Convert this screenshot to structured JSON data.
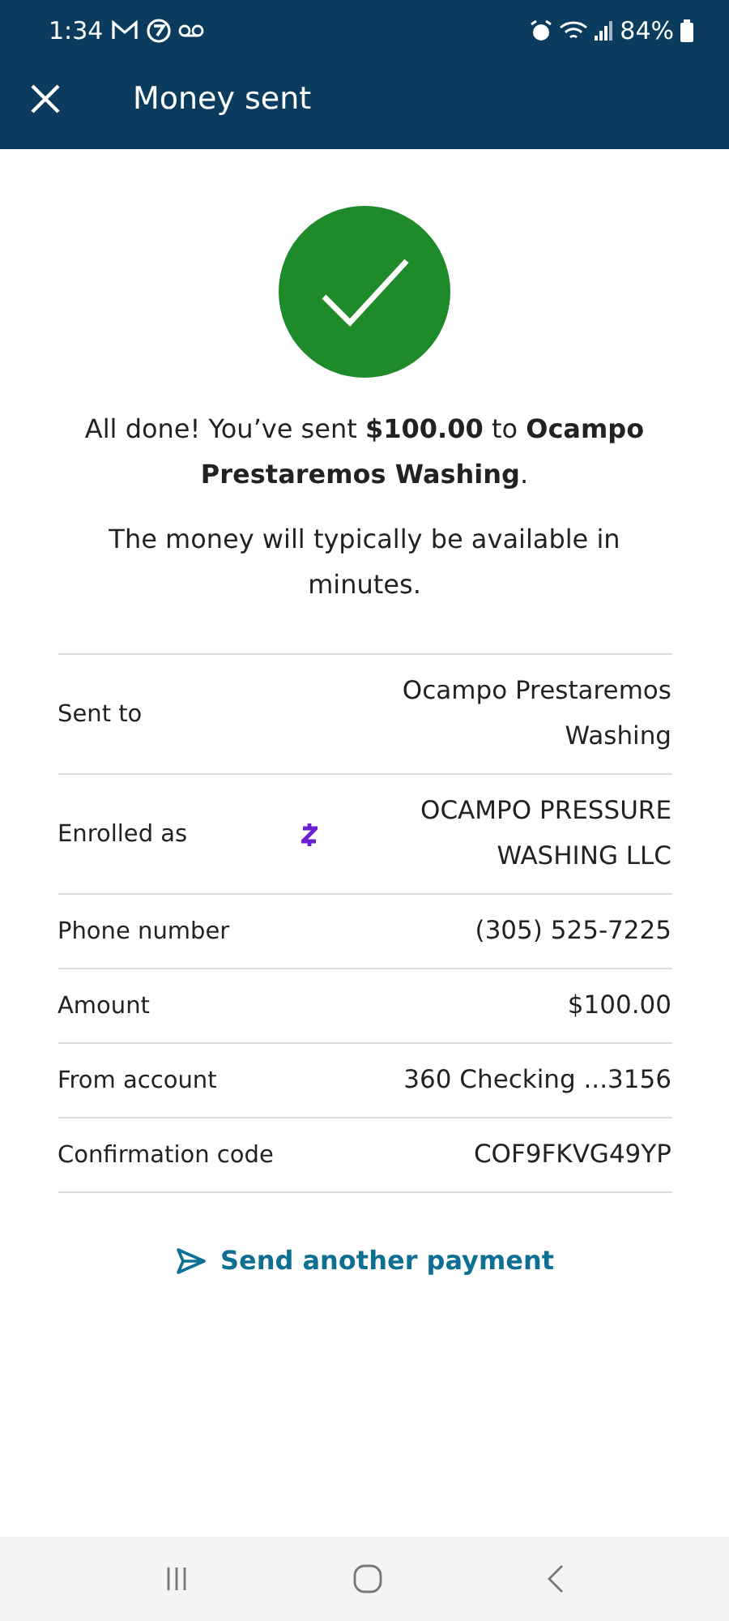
{
  "status_bar": {
    "time": "1:34",
    "battery": "84%"
  },
  "header": {
    "title": "Money sent"
  },
  "message": {
    "text": "All done! You’ve sent **$100.00** to **Ocampo Prestaremos Washing**.",
    "note": "The money will typically be available in minutes."
  },
  "details": [
    {
      "label": "Sent to",
      "value": "Ocampo Prestaremos Washing",
      "zelle_icon": false
    },
    {
      "label": "Enrolled as",
      "value": "OCAMPO PRESSURE WASHING LLC",
      "zelle_icon": true
    },
    {
      "label": "Phone number",
      "value": "(305) 525-7225",
      "zelle_icon": false
    },
    {
      "label": "Amount",
      "value": "$100.00",
      "zelle_icon": false
    },
    {
      "label": "From account",
      "value": "360 Checking ...3156",
      "zelle_icon": false
    },
    {
      "label": "Confirmation code",
      "value": "COF9FKVG49YP",
      "zelle_icon": false
    }
  ],
  "action": {
    "label": "Send another payment"
  }
}
